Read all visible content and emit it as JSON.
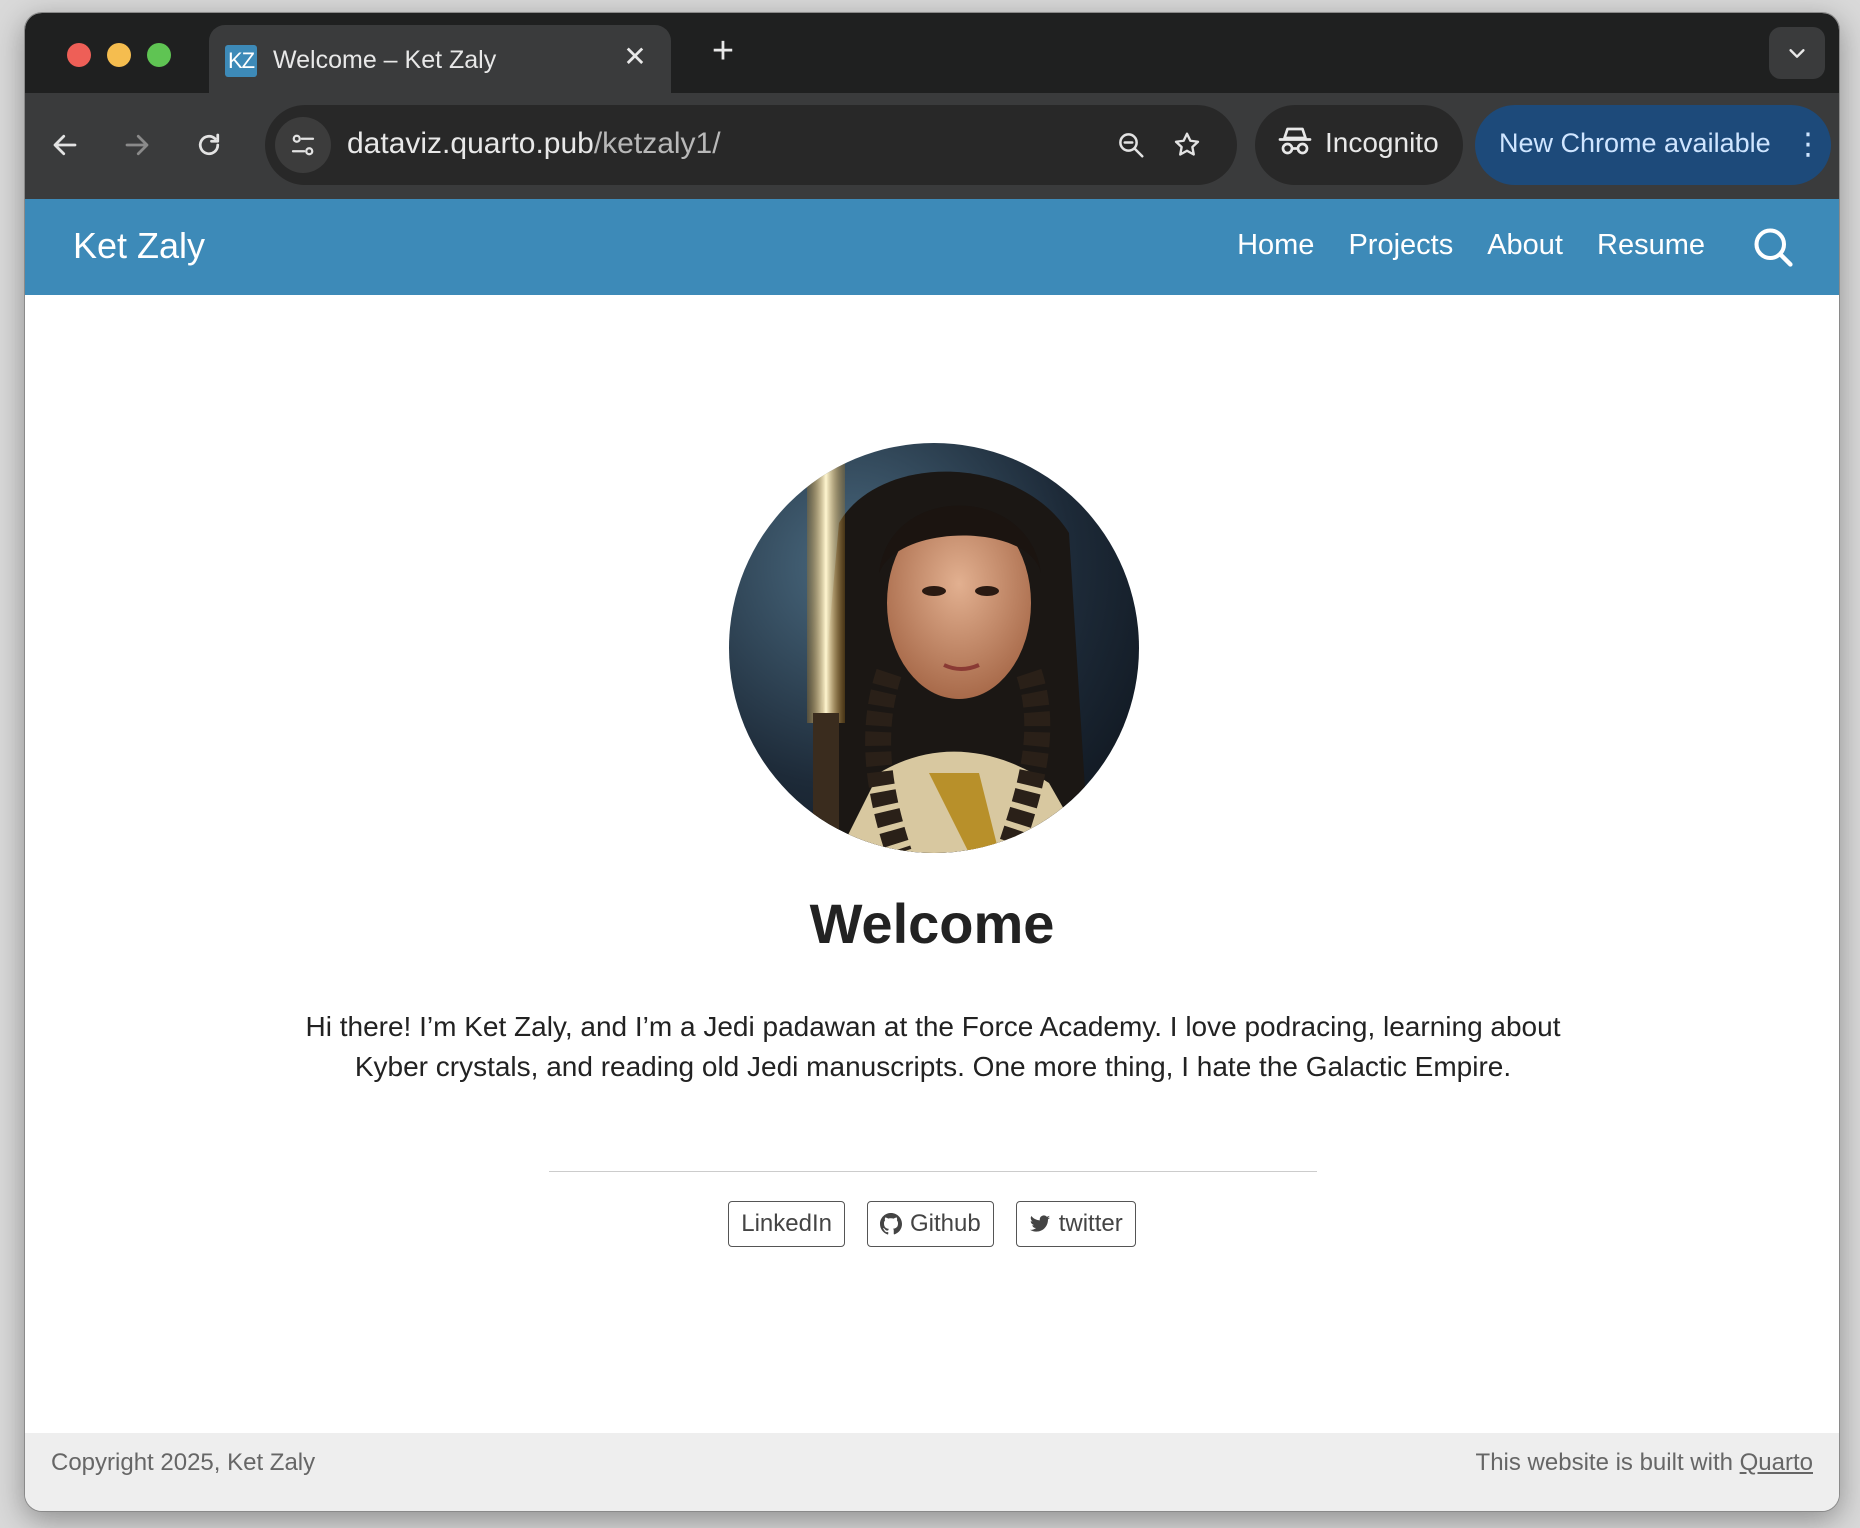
{
  "browser": {
    "tab": {
      "favicon_text": "KZ",
      "title": "Welcome – Ket Zaly",
      "close": "✕"
    },
    "new_tab": "+",
    "tab_menu_icon": "chevron-down-icon",
    "url": {
      "domain": "dataviz.quarto.pub",
      "path": "/ketzaly1/"
    },
    "incognito_label": "Incognito",
    "update_label": "New Chrome available"
  },
  "site": {
    "brand": "Ket Zaly",
    "nav": [
      "Home",
      "Projects",
      "About",
      "Resume"
    ],
    "heading": "Welcome",
    "bio_line1": "Hi there! I’m Ket Zaly, and I’m a Jedi padawan at the Force Academy. I love podracing, learning about",
    "bio_line2": "Kyber crystals, and reading old Jedi manuscripts. One more thing, I hate the Galactic Empire.",
    "links": [
      {
        "label": "LinkedIn",
        "icon": ""
      },
      {
        "label": "Github",
        "icon": "github-icon"
      },
      {
        "label": "twitter",
        "icon": "twitter-icon"
      }
    ],
    "footer_left": "Copyright 2025, Ket Zaly",
    "footer_right_prefix": "This website is built with ",
    "footer_right_link": "Quarto"
  },
  "colors": {
    "nav_bg": "#3d8ab8",
    "footer_bg": "#eeeeee",
    "update_bg": "#1d4a7a"
  }
}
